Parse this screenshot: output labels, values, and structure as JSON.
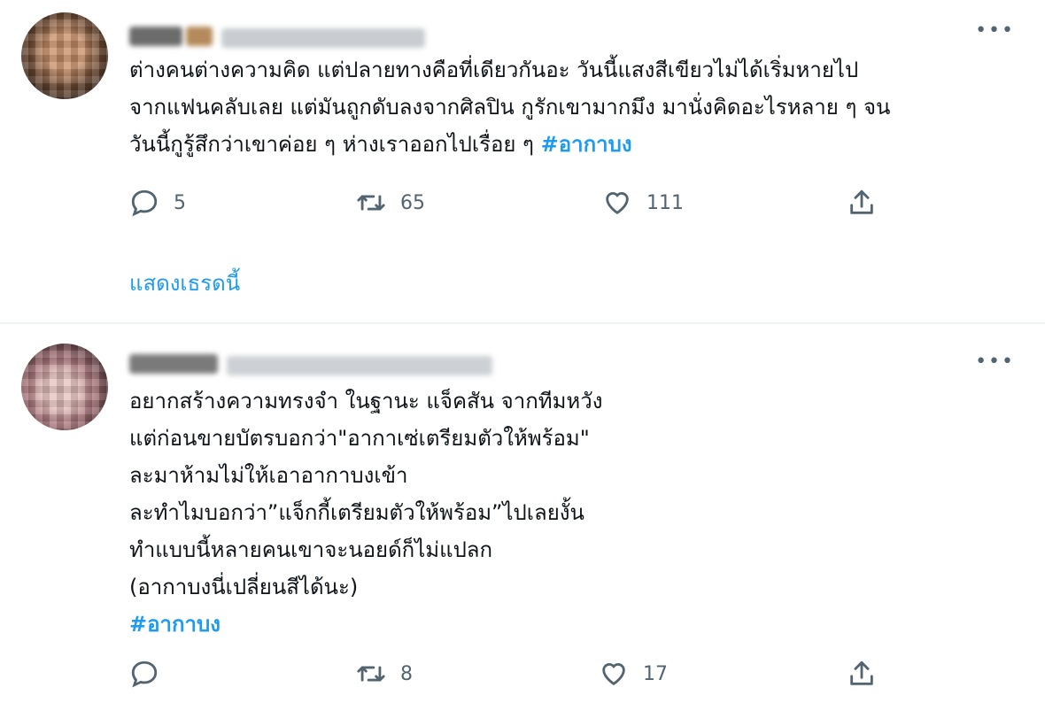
{
  "tweets": [
    {
      "text_lines": [
        "ต่างคนต่างความคิด แต่ปลายทางคือที่เดียวกันอะ วันนี้แสงสีเขียวไม่ได้เริ่มหายไป",
        "จากแฟนคลับเลย แต่มันถูกดับลงจากศิลปิน กูรักเขามากมึง มานั่งคิดอะไรหลาย ๆ จน",
        "วันนี้กูรู้สึกว่าเขาค่อย ๆ ห่างเราออกไปเรื่อย  ๆ "
      ],
      "hashtag": "#อากาบง",
      "reply_count": "5",
      "retweet_count": "65",
      "like_count": "111",
      "show_thread": "แสดงเธรดนี้",
      "more_icon": "more-icon"
    },
    {
      "text_lines": [
        "อยากสร้างความทรงจำ ในฐานะ แจ็คสัน จากทีมหวัง",
        "แต่ก่อนขายบัตรบอกว่า\"อากาเซ่เตรียมตัวให้พร้อม\"",
        "ละมาห้ามไม่ให้เอาอากาบงเข้า",
        "ละทำไมบอกว่า”แจ็กกี้เตรียมตัวให้พร้อม”ไปเลยงั้น",
        "ทำแบบนี้หลายคนเขาจะนอยด์ก็ไม่แปลก",
        "(อากาบงนี่เปลี่ยนสีได้นะ)"
      ],
      "hashtag": "#อากาบง",
      "reply_count": "",
      "retweet_count": "8",
      "like_count": "17",
      "more_icon": "more-icon"
    }
  ],
  "colors": {
    "accent": "#1d9bf0",
    "muted": "#536471",
    "text": "#0f1419",
    "divider": "#eff3f4"
  }
}
